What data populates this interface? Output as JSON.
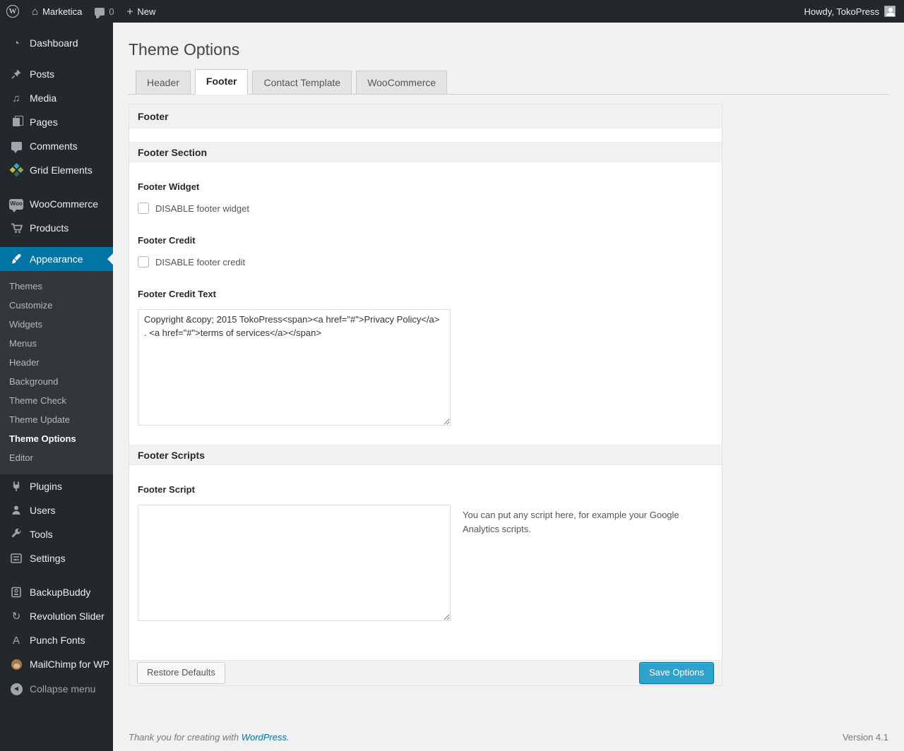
{
  "admin_bar": {
    "logo_letter": "W",
    "site_name": "Marketica",
    "comment_count": "0",
    "new_label": "New",
    "howdy": "Howdy, TokoPress"
  },
  "icons": {
    "home": "⌂",
    "dashboard": "◔",
    "media": "♫",
    "revolution": "↻",
    "punch_fonts": "A",
    "plus": "+",
    "collapse_arrow": "◀",
    "woo_badge": "Woo"
  },
  "sidebar": {
    "items": [
      {
        "label": "Dashboard"
      },
      {
        "label": "Posts"
      },
      {
        "label": "Media"
      },
      {
        "label": "Pages"
      },
      {
        "label": "Comments"
      },
      {
        "label": "Grid Elements"
      },
      {
        "label": "WooCommerce"
      },
      {
        "label": "Products"
      },
      {
        "label": "Appearance"
      },
      {
        "label": "Plugins"
      },
      {
        "label": "Users"
      },
      {
        "label": "Tools"
      },
      {
        "label": "Settings"
      },
      {
        "label": "BackupBuddy"
      },
      {
        "label": "Revolution Slider"
      },
      {
        "label": "Punch Fonts"
      },
      {
        "label": "MailChimp for WP"
      },
      {
        "label": "Collapse menu"
      }
    ],
    "appearance_submenu": [
      {
        "label": "Themes"
      },
      {
        "label": "Customize"
      },
      {
        "label": "Widgets"
      },
      {
        "label": "Menus"
      },
      {
        "label": "Header"
      },
      {
        "label": "Background"
      },
      {
        "label": "Theme Check"
      },
      {
        "label": "Theme Update"
      },
      {
        "label": "Theme Options"
      },
      {
        "label": "Editor"
      }
    ]
  },
  "page": {
    "title": "Theme Options",
    "tabs": [
      {
        "label": "Header"
      },
      {
        "label": "Footer"
      },
      {
        "label": "Contact Template"
      },
      {
        "label": "WooCommerce"
      }
    ]
  },
  "panel": {
    "header": "Footer",
    "section_header": "Footer Section",
    "footer_widget_label": "Footer Widget",
    "footer_widget_checkbox_label": "DISABLE footer widget",
    "footer_credit_label": "Footer Credit",
    "footer_credit_checkbox_label": "DISABLE footer credit",
    "footer_credit_text_label": "Footer Credit Text",
    "footer_credit_text_value": "Copyright &copy; 2015 TokoPress<span><a href=\"#\">Privacy Policy</a> . <a href=\"#\">terms of services</a></span>",
    "scripts_header": "Footer Scripts",
    "footer_script_label": "Footer Script",
    "footer_script_value": "",
    "footer_script_help": "You can put any script here, for example your Google Analytics scripts.",
    "restore_button": "Restore Defaults",
    "save_button": "Save Options"
  },
  "footer": {
    "thanks_prefix": "Thank you for creating with ",
    "wordpress_link": "WordPress.",
    "version": "Version 4.1"
  },
  "colors": {
    "admin_dark": "#23282d",
    "menu_active": "#0074a2",
    "primary_button": "#2ea2cc",
    "page_background": "#f1f1f1"
  }
}
